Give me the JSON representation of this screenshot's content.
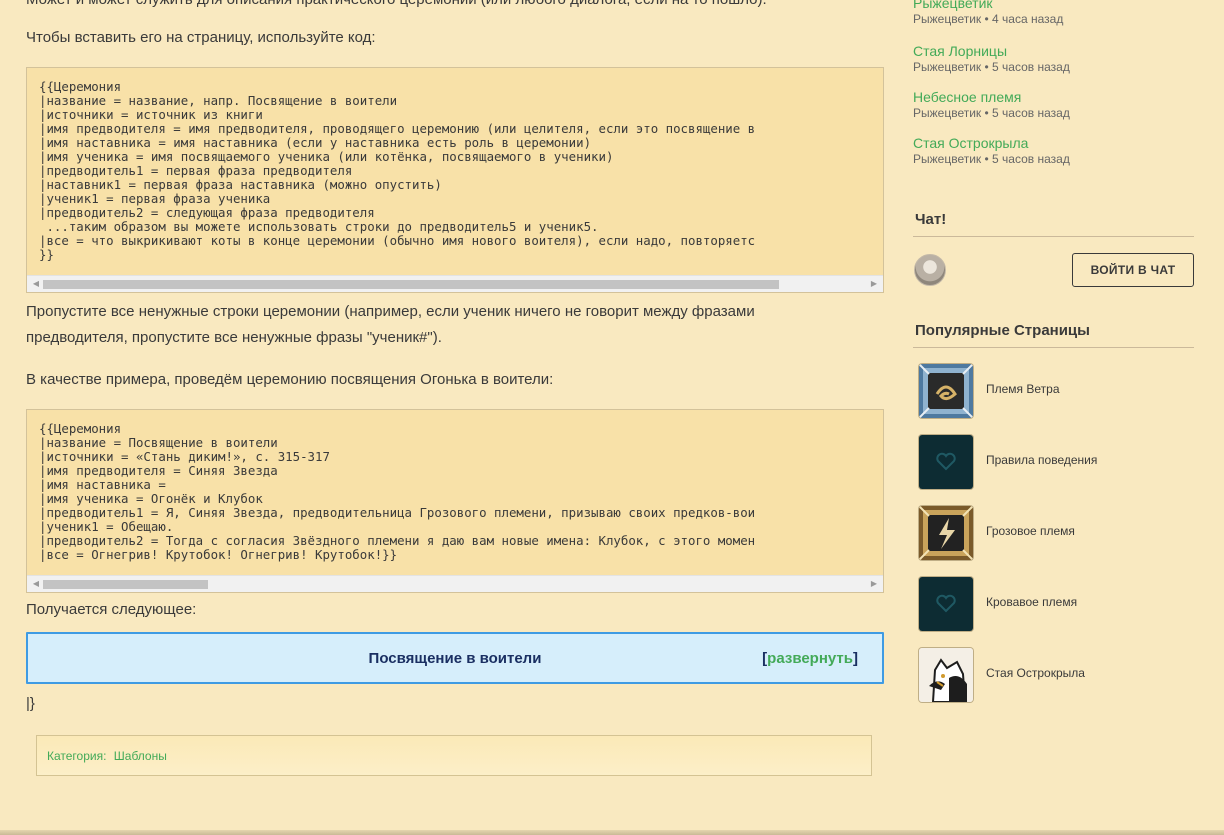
{
  "main": {
    "partial_top_line": "Может и может служить для описания практического церемонии (или любого диалога, если на то пошло).",
    "intro": "Чтобы вставить его на страницу, используйте код:",
    "code1": "{{Церемония\n|название = название, напр. Посвящение в воители\n|источники = источник из книги\n|имя предводителя = имя предводителя, проводящего церемонию (или целителя, если это посвящение в\n|имя наставника = имя наставника (если у наставника есть роль в церемонии)\n|имя ученика = имя посвящаемого ученика (или котёнка, посвящаемого в ученики)\n|предводитель1 = первая фраза предводителя\n|наставник1 = первая фраза наставника (можно опустить)\n|ученик1 = первая фраза ученика\n|предводитель2 = следующая фраза предводителя\n ...таким образом вы можете использовать строки до предводитель5 и ученик5.\n|все = что выкрикивают коты в конце церемонии (обычно имя нового воителя), если надо, повторяетс\n}}",
    "skip_text": "Пропустите все ненужные строки церемонии (например, если ученик ничего не говорит между фразами предводителя, пропустите все ненужные фразы \"ученик#\").",
    "example_intro": "В качестве примера, проведём церемонию посвящения Огонька в воители:",
    "code2": "{{Церемония\n|название = Посвящение в воители\n|источники = «Стань диким!», с. 315-317\n|имя предводителя = Синяя Звезда\n|имя наставника =\n|имя ученика = Огонёк и Клубок\n|предводитель1 = Я, Синяя Звезда, предводительница Грозового племени, призываю своих предков-вои\n|ученик1 = Обещаю.\n|предводитель2 = Тогда с согласия Звёздного племени я даю вам новые имена: Клубок, с этого момен\n|все = Огнегрив! Крутобок! Огнегрив! Крутобок!}}",
    "result_intro": "Получается следующее:",
    "navbox": {
      "title": "Посвящение в воители",
      "open_bracket": "[",
      "toggle_label": "развернуть",
      "close_bracket": "]"
    },
    "trailing": "|}",
    "category": {
      "label": "Категория:",
      "value": "Шаблоны"
    }
  },
  "sidebar": {
    "activity": [
      {
        "title": "Рыжецветик",
        "meta": "Рыжецветик • 4 часа назад"
      },
      {
        "title": "Стая Лорницы",
        "meta": "Рыжецветик • 5 часов назад"
      },
      {
        "title": "Небесное племя",
        "meta": "Рыжецветик • 5 часов назад"
      },
      {
        "title": "Стая Острокрыла",
        "meta": "Рыжецветик • 5 часов назад"
      }
    ],
    "chat": {
      "title": "Чат!",
      "button": "ВОЙТИ В ЧАТ"
    },
    "popular": {
      "title": "Популярные Страницы",
      "items": [
        {
          "label": "Племя Ветра",
          "icon": "wind-clan-icon"
        },
        {
          "label": "Правила поведения",
          "icon": "wiki-heart-icon"
        },
        {
          "label": "Грозовое племя",
          "icon": "thunder-clan-icon"
        },
        {
          "label": "Кровавое племя",
          "icon": "wiki-heart-icon"
        },
        {
          "label": "Стая Острокрыла",
          "icon": "cat-icon"
        }
      ]
    }
  },
  "colors": {
    "background": "#f9e9c0",
    "link": "#43aa58",
    "code_bg": "#f8e1a8",
    "navbox_bg": "#d6eefb",
    "navbox_border": "#3f9be3"
  }
}
